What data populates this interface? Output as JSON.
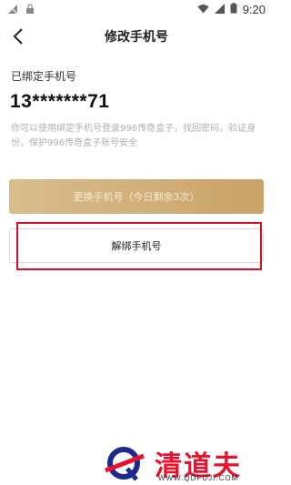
{
  "status_bar": {
    "time": "9:20"
  },
  "nav": {
    "title": "修改手机号"
  },
  "bound": {
    "label": "已绑定手机号",
    "phone": "13*******71",
    "hint": "你可以使用绑定手机号登录996传奇盒子，找回密码，验证身份，保护996传奇盒子账号安全"
  },
  "actions": {
    "change_label": "更换手机号（今日剩余3次）",
    "unbind_label": "解绑手机号"
  },
  "watermark": {
    "title": "清道夫",
    "url": "WWW.QDFUJI.COM"
  },
  "colors": {
    "accent_gold": "#c9a367",
    "highlight_red": "#d3102a",
    "watermark_red": "#e8122d"
  }
}
